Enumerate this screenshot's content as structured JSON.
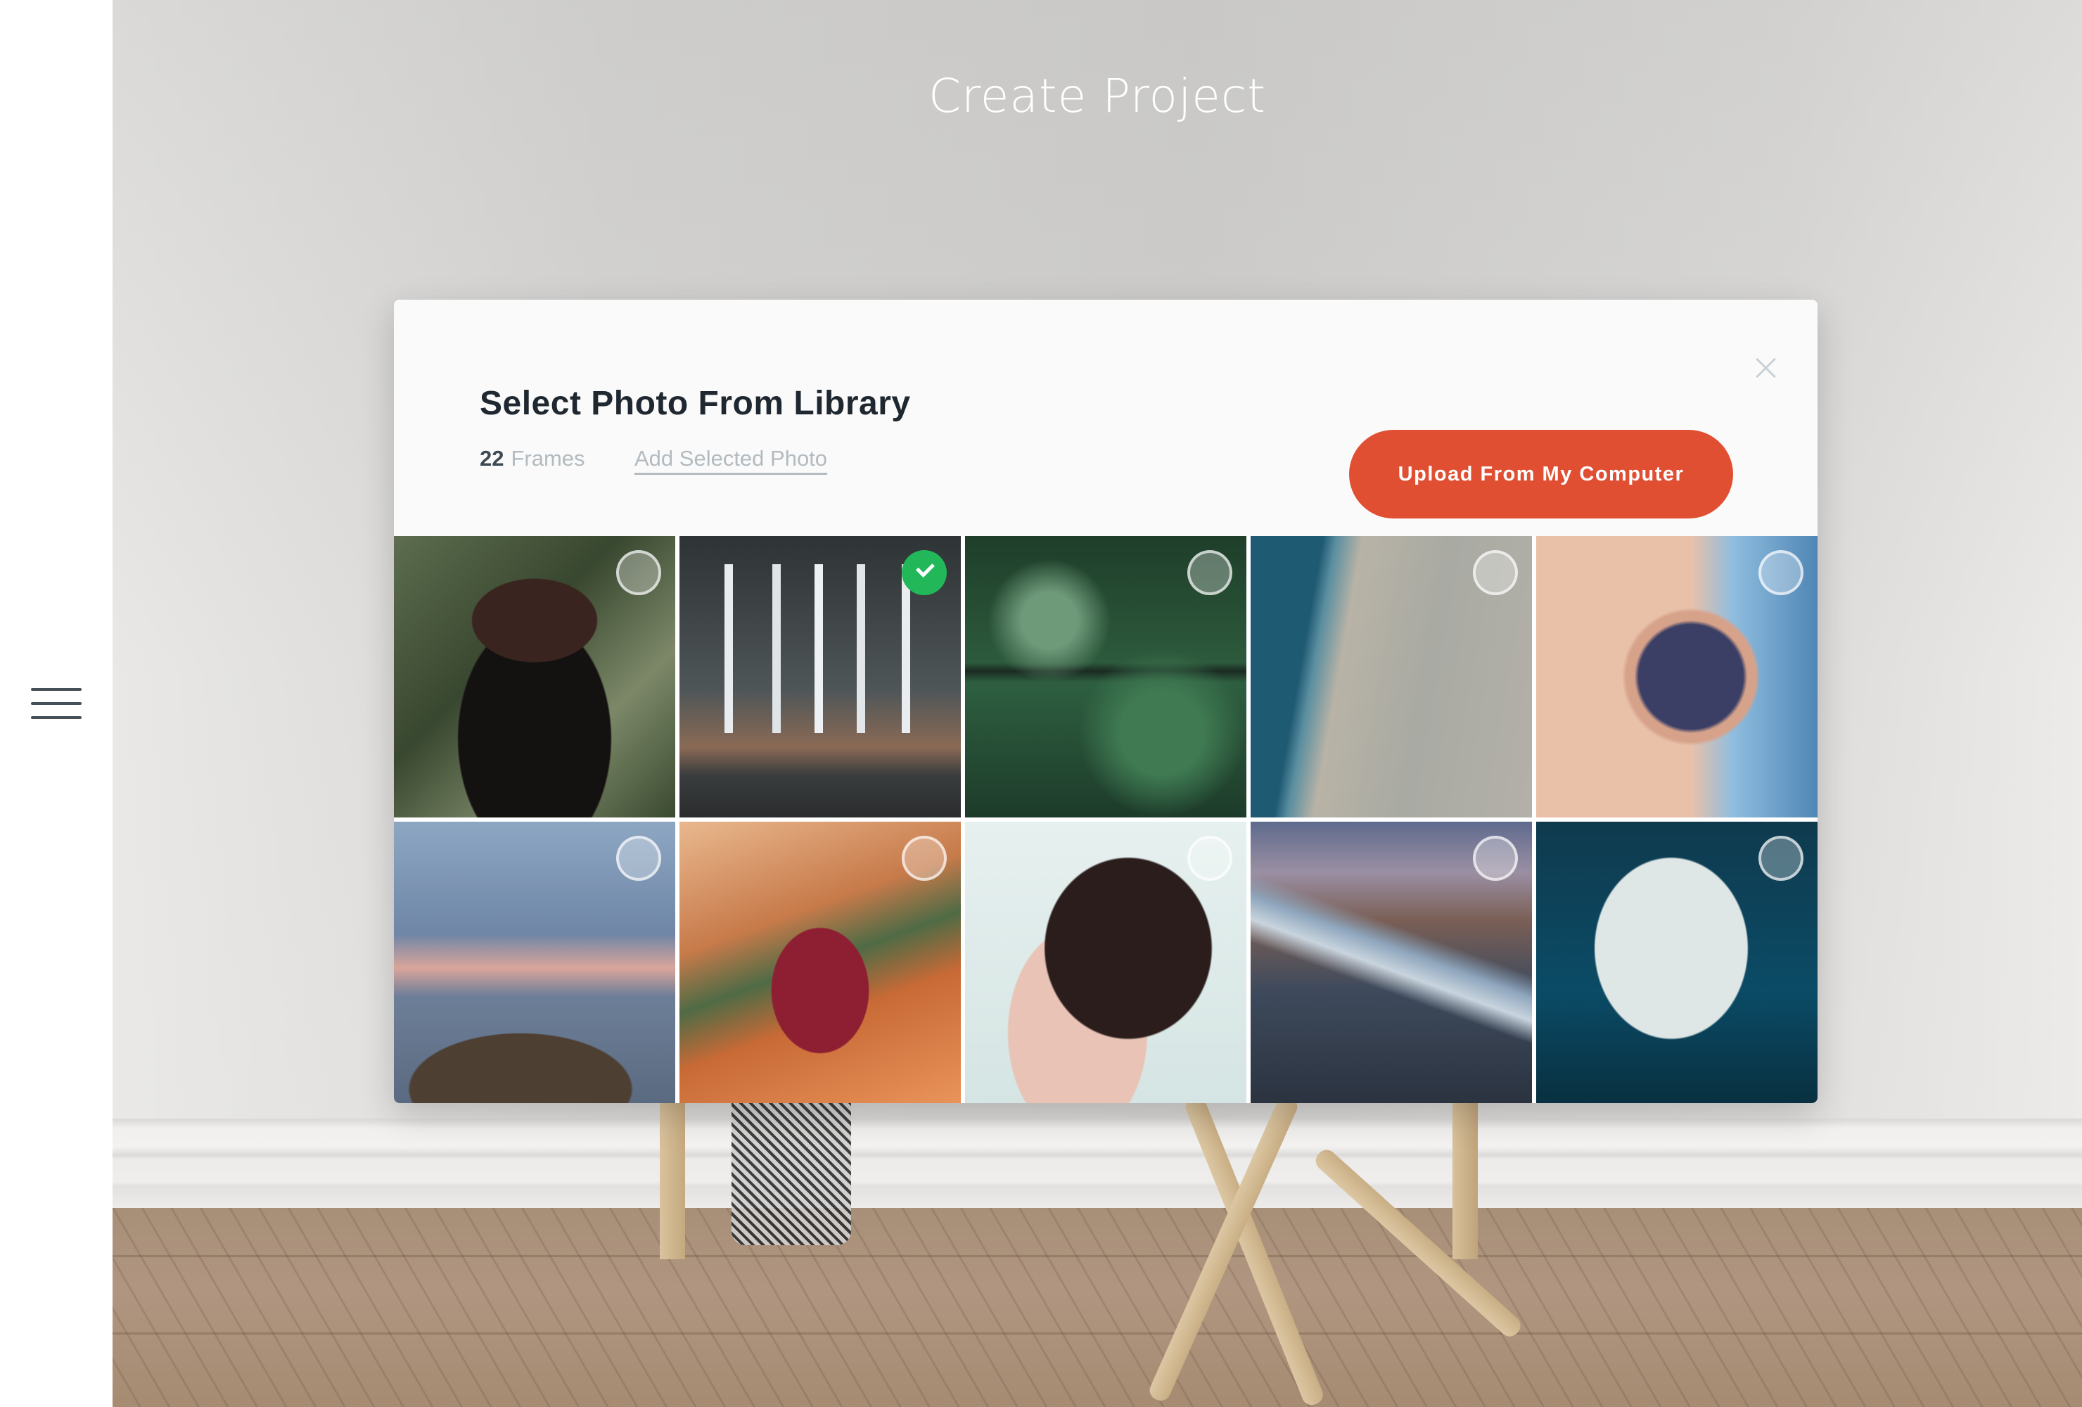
{
  "sidebar": {
    "menu_icon": "hamburger-menu-icon"
  },
  "page": {
    "title": "Create Project"
  },
  "modal": {
    "title": "Select Photo From Library",
    "frames_count": "22",
    "frames_label": "Frames",
    "add_selected_label": "Add Selected Photo",
    "upload_button_label": "Upload From My Computer",
    "close_icon": "close-icon",
    "colors": {
      "accent": "#e14f33",
      "selected": "#22b85a",
      "title_text": "#1f2830",
      "muted_text": "#b3bbc0"
    },
    "photos": [
      {
        "subject": "Woman in hat in cornfield",
        "selected": false
      },
      {
        "subject": "Church interior with tall windows",
        "selected": true
      },
      {
        "subject": "Aerial forest with road",
        "selected": false
      },
      {
        "subject": "Aerial beach shoreline",
        "selected": false
      },
      {
        "subject": "Sunglasses close-up",
        "selected": false
      },
      {
        "subject": "Person on cliff at sunset",
        "selected": false
      },
      {
        "subject": "Man overlooking canyon",
        "selected": false
      },
      {
        "subject": "Woman with hair bun",
        "selected": false
      },
      {
        "subject": "Glacier in mountains",
        "selected": false
      },
      {
        "subject": "Egret in flight",
        "selected": false
      }
    ]
  }
}
